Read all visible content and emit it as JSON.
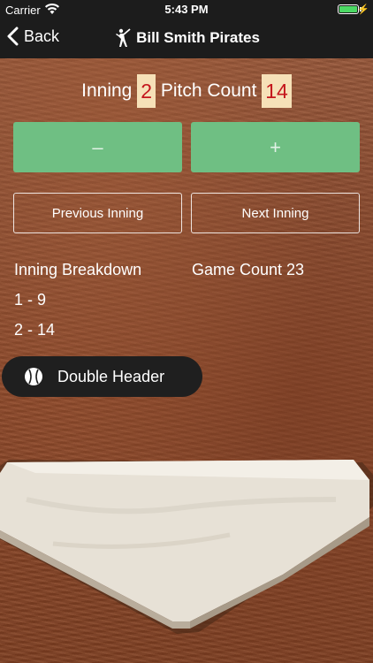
{
  "status_bar": {
    "carrier": "Carrier",
    "time": "5:43 PM",
    "battery_color": "#4cd964"
  },
  "nav": {
    "back_label": "Back",
    "title": "Bill Smith Pirates",
    "player_icon": "batter-icon"
  },
  "counts": {
    "inning_label": "Inning",
    "inning_value": "2",
    "pitch_label": "Pitch Count",
    "pitch_value": "14"
  },
  "buttons": {
    "decrement_label": "–",
    "increment_label": "+",
    "previous_label": "Previous Inning",
    "next_label": "Next Inning"
  },
  "breakdown": {
    "title": "Inning Breakdown",
    "game_count": "Game Count 23",
    "rows": [
      "1 - 9",
      "2 - 14"
    ]
  },
  "double_header": {
    "label": "Double Header",
    "icon": "baseball-icon"
  },
  "colors": {
    "green_button": "#6fbf83",
    "count_bg": "#f6e1b8",
    "count_text": "#c4161c",
    "nav_bg": "#1c1c1c"
  }
}
